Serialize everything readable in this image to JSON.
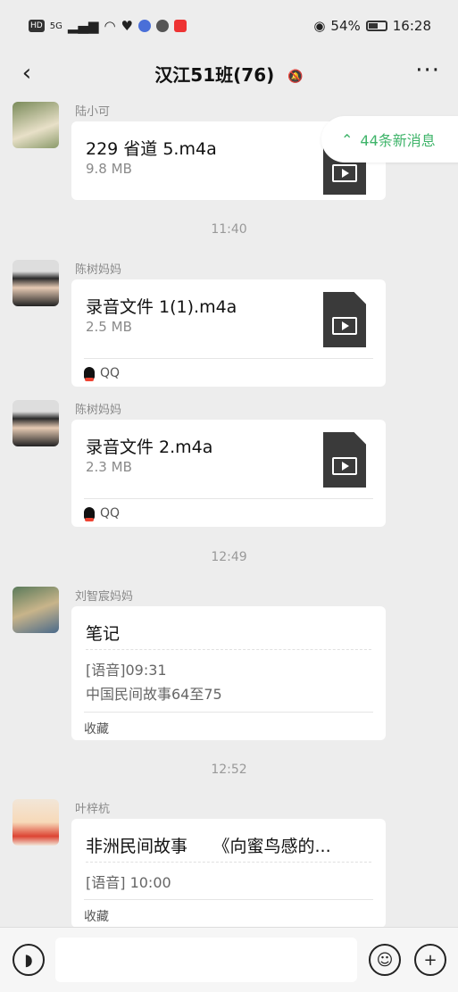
{
  "status_bar": {
    "left_badge": "HD",
    "signal": "5G",
    "battery": "54%",
    "time": "16:28"
  },
  "header": {
    "title": "汉江51班(76)",
    "back_icon": "chevron-left-icon",
    "mute_icon": "bell-off-icon",
    "more_icon": "more-icon"
  },
  "new_messages": {
    "label": "44条新消息",
    "icon": "double-chevron-up-icon"
  },
  "messages": [
    {
      "sender": "陆小可",
      "file_name": "229 省道 5.m4a",
      "file_size": "9.8 MB"
    },
    {
      "timestamp": "11:40"
    },
    {
      "sender": "陈树妈妈",
      "file_name": "录音文件 1(1).m4a",
      "file_size": "2.5 MB",
      "source": "QQ"
    },
    {
      "sender": "陈树妈妈",
      "file_name": "录音文件 2.m4a",
      "file_size": "2.3 MB",
      "source": "QQ"
    },
    {
      "timestamp": "12:49"
    },
    {
      "sender": "刘智宸妈妈",
      "note_title": "笔记",
      "line1": "[语音]09:31",
      "line2": "中国民间故事64至75",
      "footer": "收藏"
    },
    {
      "timestamp": "12:52"
    },
    {
      "sender": "叶梓杭",
      "note_title": "非洲民间故事　　《向蜜鸟感的...",
      "line1": "[语音] 10:00",
      "footer": "收藏"
    }
  ],
  "input_bar": {
    "voice_icon": "voice-icon",
    "emoji_icon": "emoji-icon",
    "plus_icon": "plus-icon"
  }
}
